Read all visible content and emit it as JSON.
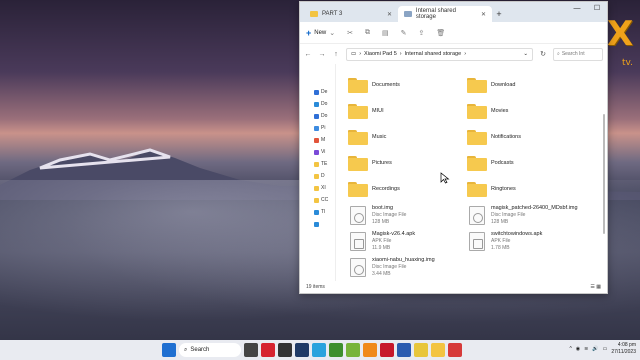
{
  "window": {
    "tabs": [
      {
        "label": "PART 3",
        "active": false
      },
      {
        "label": "Internal shared storage",
        "active": true
      }
    ],
    "new_label": "New",
    "view_label": "View",
    "breadcrumb": [
      "Xiaomi Pad 5",
      "Internal shared storage"
    ],
    "search_placeholder": "Search Int",
    "sidebar": [
      {
        "label": "De",
        "color": "#2f6fd6"
      },
      {
        "label": "Do",
        "color": "#2a8bd8"
      },
      {
        "label": "Do",
        "color": "#2f6fd6"
      },
      {
        "label": "Pi",
        "color": "#3d8be0"
      },
      {
        "label": "M",
        "color": "#e2553a"
      },
      {
        "label": "Vi",
        "color": "#7a4ad8"
      },
      {
        "label": "TE",
        "color": "#f3c442"
      },
      {
        "label": "D",
        "color": "#f3c442"
      },
      {
        "label": "XI",
        "color": "#f3c442"
      },
      {
        "label": "CC",
        "color": "#f3c442"
      },
      {
        "label": "Tl",
        "color": "#2a8bd8"
      },
      {
        "label": "",
        "color": "#2a8bd8"
      }
    ],
    "folders": [
      "Documents",
      "Download",
      "MIUI",
      "Movies",
      "Music",
      "Notifications",
      "Pictures",
      "Podcasts",
      "Recordings",
      "Ringtones"
    ],
    "files": [
      {
        "name": "boot.img",
        "type": "Disc Image File",
        "size": "128 MB",
        "kind": "disc"
      },
      {
        "name": "magisk_patched-26400_MDsbf.img",
        "type": "Disc Image File",
        "size": "128 MB",
        "kind": "disc"
      },
      {
        "name": "Magisk-v26.4.apk",
        "type": "APK File",
        "size": "11.9 MB",
        "kind": "apk"
      },
      {
        "name": "switchtowindows.apk",
        "type": "APK File",
        "size": "1.78 MB",
        "kind": "apk"
      },
      {
        "name": "xiaomi-nabu_huaxing.img",
        "type": "Disc Image File",
        "size": "3.44 MB",
        "kind": "disc"
      }
    ],
    "status_count": "19 items"
  },
  "logo": {
    "main": "VERAX",
    "suffix": "tv."
  },
  "taskbar": {
    "search_label": "Search",
    "time": "4:08 pm",
    "date": "27/11/2023",
    "icons": [
      {
        "name": "windows-start-icon",
        "color": "#1f6fd1"
      },
      {
        "name": "search-pill",
        "color": "#ffffff"
      },
      {
        "name": "taskview-icon",
        "color": "#444"
      },
      {
        "name": "opera-icon",
        "color": "#d6232f"
      },
      {
        "name": "app-icon",
        "color": "#333"
      },
      {
        "name": "stocks-icon",
        "color": "#1f3a66"
      },
      {
        "name": "telegram-icon",
        "color": "#2aa3dd"
      },
      {
        "name": "game-icon",
        "color": "#3e8f2e"
      },
      {
        "name": "torrent-icon",
        "color": "#78b43a"
      },
      {
        "name": "vpn-icon",
        "color": "#f08a1a"
      },
      {
        "name": "opera-gx-icon",
        "color": "#c7172b"
      },
      {
        "name": "word-icon",
        "color": "#2b5cb0"
      },
      {
        "name": "chrome-icon",
        "color": "#e8c63b"
      },
      {
        "name": "file-explorer-icon",
        "color": "#f3c442"
      },
      {
        "name": "app2-icon",
        "color": "#d63a3a"
      }
    ]
  }
}
